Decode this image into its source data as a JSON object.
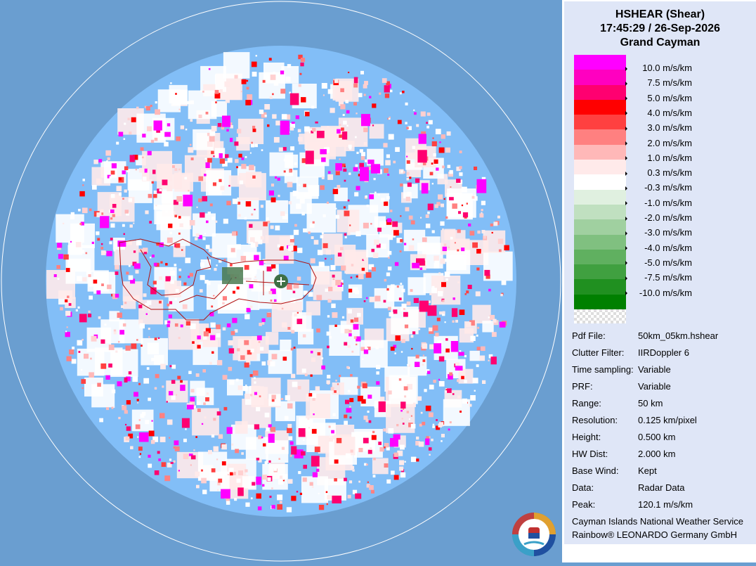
{
  "header": {
    "product": "HSHEAR (Shear)",
    "datetime": "17:45:29 / 26-Sep-2026",
    "site": "Grand Cayman"
  },
  "legend": {
    "colors": [
      "#ff00ff",
      "#ff00c0",
      "#ff0070",
      "#ff0000",
      "#ff4040",
      "#ff8080",
      "#ffb8b8",
      "#ffeaea",
      "#ffffff",
      "#e0f0e0",
      "#c0e0c0",
      "#a0d0a0",
      "#80c080",
      "#60b060",
      "#40a040",
      "#209020",
      "#008000"
    ],
    "labels": [
      "10.0 m/s/km",
      "7.5 m/s/km",
      "5.0 m/s/km",
      "4.0 m/s/km",
      "3.0 m/s/km",
      "2.0 m/s/km",
      "1.0 m/s/km",
      "0.3 m/s/km",
      "-0.3 m/s/km",
      "-1.0 m/s/km",
      "-2.0 m/s/km",
      "-3.0 m/s/km",
      "-4.0 m/s/km",
      "-5.0 m/s/km",
      "-7.5 m/s/km",
      "-10.0 m/s/km"
    ]
  },
  "info": [
    {
      "key": "Pdf File:",
      "value": "50km_05km.hshear"
    },
    {
      "key": "Clutter Filter:",
      "value": "IIRDoppler 6"
    },
    {
      "key": "Time sampling:",
      "value": "Variable"
    },
    {
      "key": "PRF:",
      "value": "Variable"
    },
    {
      "key": "Range:",
      "value": "50 km"
    },
    {
      "key": "Resolution:",
      "value": "0.125 km/pixel"
    },
    {
      "key": "Height:",
      "value": "0.500 km"
    },
    {
      "key": "HW Dist:",
      "value": "2.000 km"
    },
    {
      "key": "Base Wind:",
      "value": "Kept"
    },
    {
      "key": "Data:",
      "value": "Radar Data"
    },
    {
      "key": "Peak:",
      "value": "120.1 m/s/km"
    }
  ],
  "footer": {
    "line1": "Cayman Islands National Weather Service",
    "line2": "Rainbow® LEONARDO Germany GmbH"
  },
  "colors": {
    "background": "#6a9ed0",
    "coverage": "#82bef7",
    "panel": "#dfe6f7"
  },
  "icons": [
    "radar-site-icon",
    "cayman-weather-service-logo-icon"
  ]
}
